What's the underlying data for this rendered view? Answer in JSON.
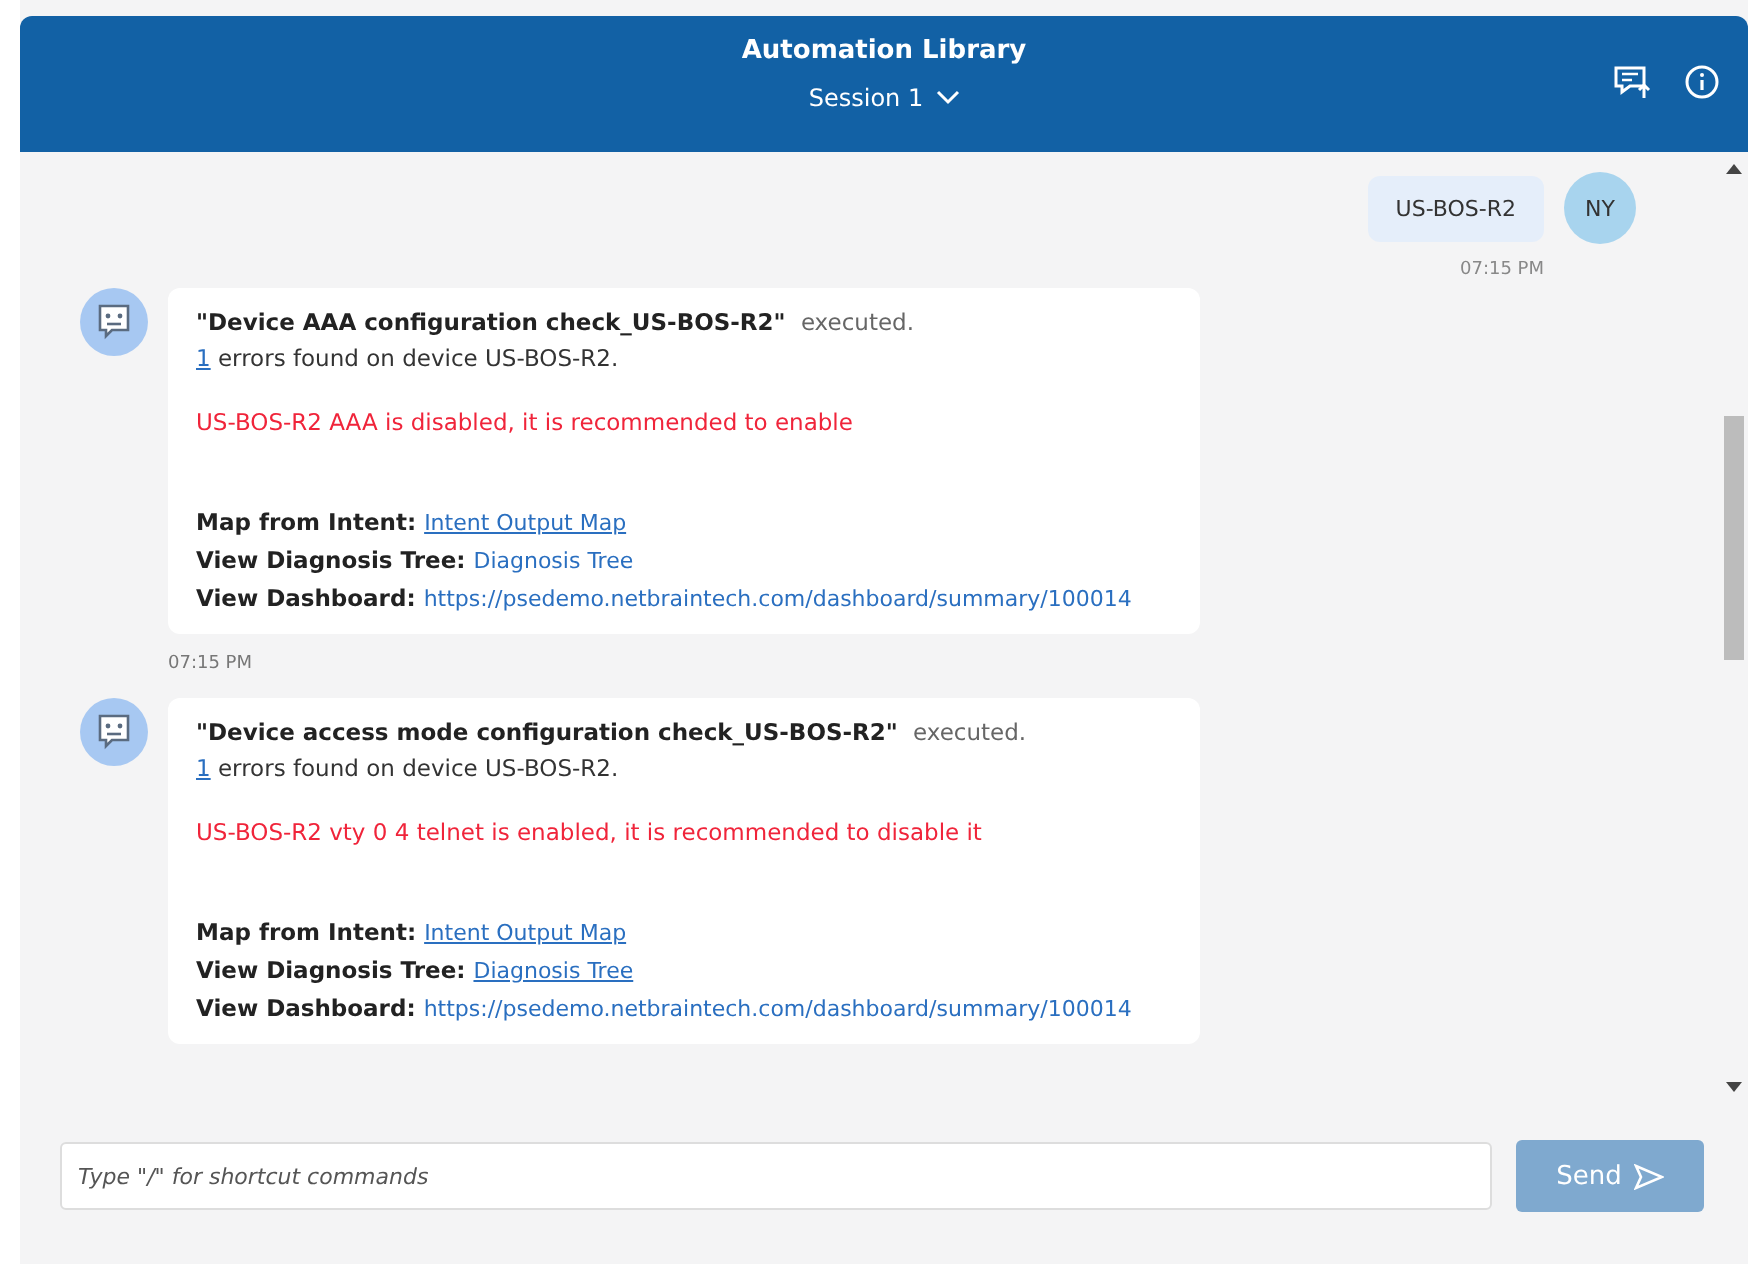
{
  "header": {
    "title": "Automation Library",
    "session": "Session 1"
  },
  "messages": [
    {
      "kind": "user",
      "avatar": "NY",
      "text": "US-BOS-R2",
      "time": "07:15 PM"
    },
    {
      "kind": "bot",
      "title": "\"Device AAA configuration check_US-BOS-R2\"",
      "status": "executed.",
      "count": "1",
      "count_text": "errors found on device US-BOS-R2.",
      "alert": "US-BOS-R2 AAA is disabled, it is recommended to enable",
      "links": [
        {
          "label": "Map from Intent:",
          "text": "Intent Output Map",
          "underlined": true
        },
        {
          "label": "View Diagnosis Tree:",
          "text": "Diagnosis Tree",
          "underlined": false
        },
        {
          "label": "View Dashboard:",
          "text": "https://psedemo.netbraintech.com/dashboard/summary/100014",
          "underlined": false
        }
      ],
      "time": "07:15 PM"
    },
    {
      "kind": "bot",
      "title": "\"Device access mode configuration check_US-BOS-R2\"",
      "status": "executed.",
      "count": "1",
      "count_text": "errors found on device US-BOS-R2.",
      "alert": "US-BOS-R2 vty 0 4 telnet is enabled, it is recommended to disable it",
      "links": [
        {
          "label": "Map from Intent:",
          "text": "Intent Output Map",
          "underlined": true
        },
        {
          "label": "View Diagnosis Tree:",
          "text": "Diagnosis Tree",
          "underlined": true
        },
        {
          "label": "View Dashboard:",
          "text": "https://psedemo.netbraintech.com/dashboard/summary/100014",
          "underlined": false
        }
      ]
    }
  ],
  "composer": {
    "placeholder": "Type \"/\" for shortcut commands",
    "send": "Send"
  }
}
